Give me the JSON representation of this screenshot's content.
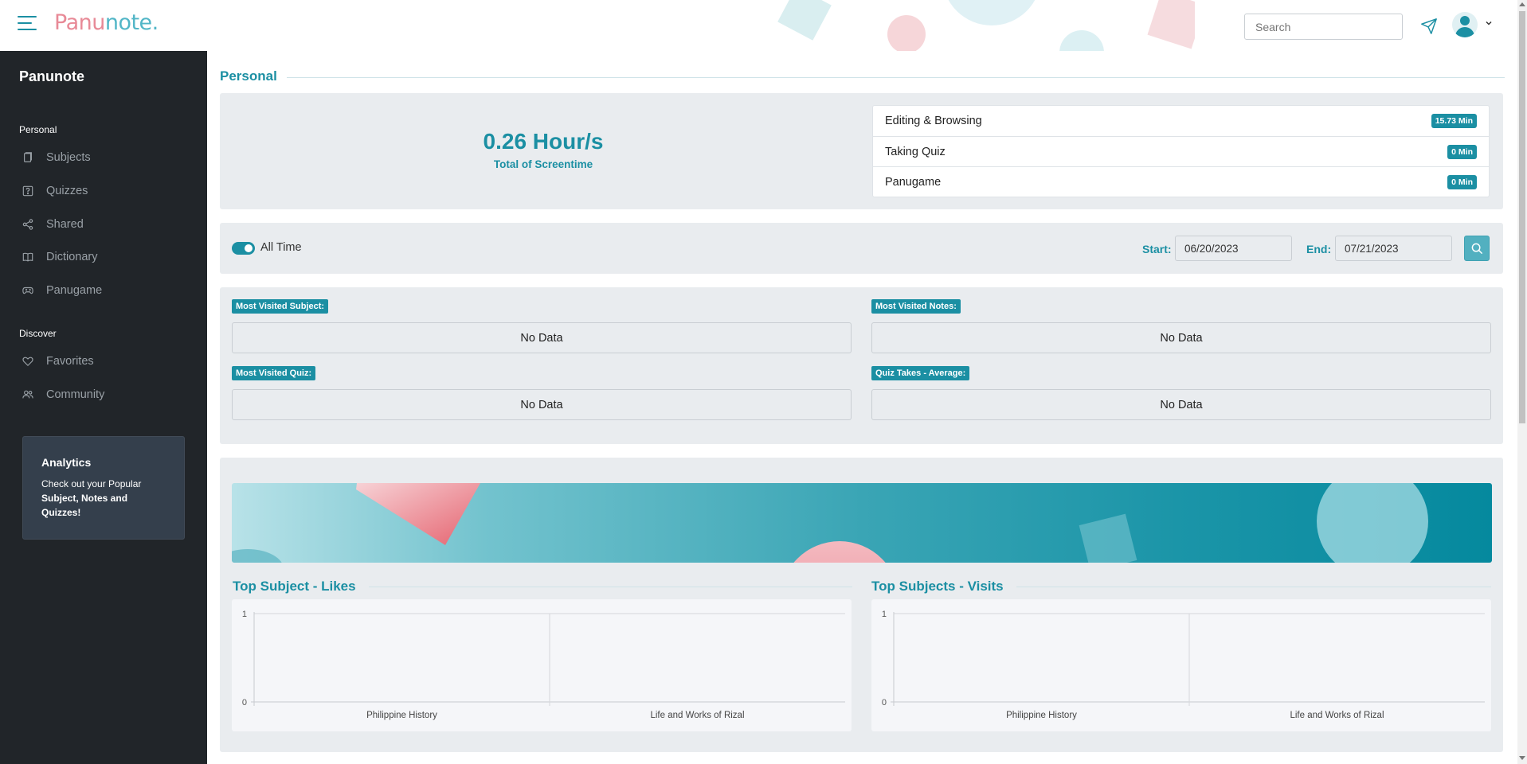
{
  "topbar": {
    "logo": {
      "part1": "Panu",
      "part2": "note."
    },
    "search_placeholder": "Search"
  },
  "sidebar": {
    "brand": "Panunote",
    "sections": [
      {
        "title": "Personal",
        "items": [
          {
            "label": "Subjects",
            "icon": "book-icon"
          },
          {
            "label": "Quizzes",
            "icon": "question-square-icon"
          },
          {
            "label": "Shared",
            "icon": "share-icon"
          },
          {
            "label": "Dictionary",
            "icon": "open-book-icon"
          },
          {
            "label": "Panugame",
            "icon": "controller-icon"
          }
        ]
      },
      {
        "title": "Discover",
        "items": [
          {
            "label": "Favorites",
            "icon": "heart-icon"
          },
          {
            "label": "Community",
            "icon": "people-icon"
          }
        ]
      }
    ],
    "promo": {
      "title": "Analytics",
      "text_start": "Check out your Popular ",
      "text_bold": "Subject, Notes and Quizzes!"
    }
  },
  "main": {
    "section_title": "Personal",
    "screentime": {
      "value": "0.26 Hour/s",
      "label": "Total of Screentime",
      "items": [
        {
          "label": "Editing & Browsing",
          "value": "15.73 Min"
        },
        {
          "label": "Taking Quiz",
          "value": "0 Min"
        },
        {
          "label": "Panugame",
          "value": "0 Min"
        }
      ]
    },
    "filter": {
      "toggle_label": "All Time",
      "toggle_on": true,
      "start_label": "Start:",
      "start_value": "06/20/2023",
      "end_label": "End:",
      "end_value": "07/21/2023"
    },
    "most_visited": [
      {
        "label": "Most Visited Subject:",
        "value": "No Data"
      },
      {
        "label": "Most Visited Notes:",
        "value": "No Data"
      },
      {
        "label": "Most Visited Quiz:",
        "value": "No Data"
      },
      {
        "label": "Quiz Takes - Average:",
        "value": "No Data"
      }
    ],
    "colors": {
      "accent": "#1b8fa3",
      "sidebar": "#212529",
      "panel": "#e9ecef",
      "pink": "#e88a97"
    }
  },
  "chart_data": [
    {
      "type": "bar",
      "title": "Top Subject - Likes",
      "categories": [
        "Philippine History",
        "Life and Works of Rizal"
      ],
      "values": [
        0,
        0
      ],
      "ylim": [
        0,
        1
      ],
      "yticks": [
        "0",
        "1"
      ],
      "grid": true
    },
    {
      "type": "bar",
      "title": "Top Subjects - Visits",
      "categories": [
        "Philippine History",
        "Life and Works of Rizal"
      ],
      "values": [
        0,
        0
      ],
      "ylim": [
        0,
        1
      ],
      "yticks": [
        "0",
        "1"
      ],
      "grid": true
    }
  ]
}
